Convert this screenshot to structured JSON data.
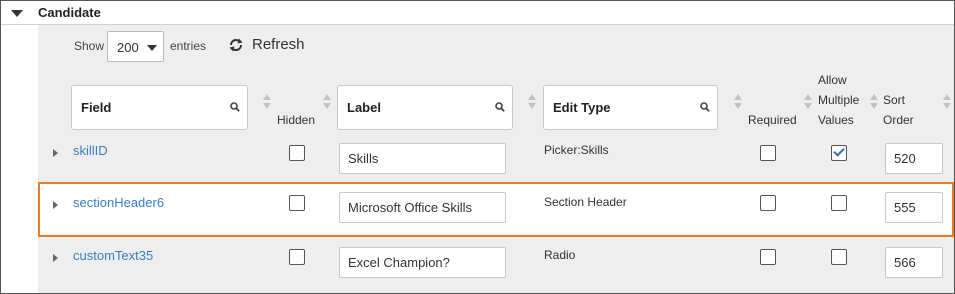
{
  "section": {
    "title": "Candidate"
  },
  "toolbar": {
    "show_label": "Show",
    "entries_value": "200",
    "entries_label": "entries",
    "refresh_label": "Refresh"
  },
  "columns": {
    "field": "Field",
    "hidden": "Hidden",
    "label": "Label",
    "edit_type": "Edit Type",
    "required": "Required",
    "allow_multiple_values": [
      "Allow",
      "Multiple",
      "Values"
    ],
    "sort_order": [
      "Sort",
      "Order"
    ]
  },
  "rows": [
    {
      "field": "skillID",
      "hidden": false,
      "label": "Skills",
      "edit_type": "Picker:Skills",
      "required": false,
      "allow_multiple": true,
      "sort_order": "520"
    },
    {
      "field": "sectionHeader6",
      "hidden": false,
      "label": "Microsoft Office Skills",
      "edit_type": "Section Header",
      "required": false,
      "allow_multiple": false,
      "sort_order": "555"
    },
    {
      "field": "customText35",
      "hidden": false,
      "label": "Excel Champion?",
      "edit_type": "Radio",
      "required": false,
      "allow_multiple": false,
      "sort_order": "566"
    }
  ],
  "colors": {
    "link": "#3a7fc1",
    "highlight": "#f07b1d",
    "panel_bg": "#eeeeee"
  },
  "icons": {
    "section_toggle": "caret-down-icon",
    "refresh": "refresh-icon",
    "search": "search-icon",
    "sort": "sort-arrows-icon",
    "expand": "caret-right-icon"
  }
}
